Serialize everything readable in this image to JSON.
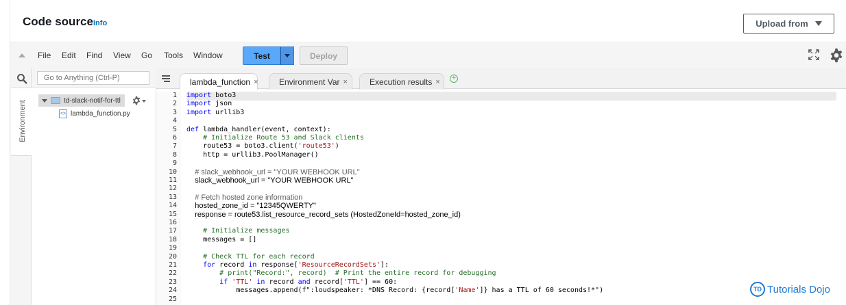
{
  "header": {
    "title": "Code source",
    "info": "Info",
    "upload": "Upload from"
  },
  "menu": {
    "items": [
      "File",
      "Edit",
      "Find",
      "View",
      "Go",
      "Tools",
      "Window"
    ],
    "test": "Test",
    "deploy": "Deploy"
  },
  "sidebar": {
    "search_placeholder": "Go to Anything (Ctrl-P)",
    "environment_tab": "Environment",
    "folder": "td-slack-notif-for-ttl",
    "file": "lambda_function.py"
  },
  "tabs": [
    {
      "label": "lambda_function",
      "close": "×"
    },
    {
      "label": "Environment Var",
      "close": "×"
    },
    {
      "label": "Execution results",
      "close": "×"
    }
  ],
  "add_tab": "+",
  "code_lines": [
    "import boto3",
    "import json",
    "import urllib3",
    "",
    "def lambda_handler(event, context):",
    "    # Initialize Route 53 and Slack clients",
    "    route53 = boto3.client('route53')",
    "    http = urllib3.PoolManager()",
    "",
    "    # slack_webhook_url = \"YOUR WEBHOOK URL\"",
    "    slack_webhook_url = \"YOUR WEBHOOK URL\"",
    "",
    "    # Fetch hosted zone information",
    "    hosted_zone_id = \"12345QWERTY\"",
    "    response = route53.list_resource_record_sets (HostedZoneId=hosted_zone_id)",
    "",
    "    # Initialize messages",
    "    messages = []",
    "",
    "    # Check TTL for each record",
    "    for record in response['ResourceRecordSets']:",
    "        # print(\"Record:\", record)  # Print the entire record for debugging",
    "        if 'TTL' in record and record['TTL'] == 60:",
    "            messages.append(f\":loudspeaker: *DNS Record: {record['Name']} has a TTL of 60 seconds!*\")",
    ""
  ],
  "line_numbers": [
    "1",
    "2",
    "3",
    "4",
    "5",
    "6",
    "7",
    "8",
    "9",
    "10",
    "11",
    "12",
    "13",
    "14",
    "15",
    "16",
    "17",
    "18",
    "19",
    "20",
    "21",
    "22",
    "23",
    "24",
    "25"
  ],
  "watermark": {
    "badge": "TD",
    "text": "Tutorials Dojo"
  },
  "colors": {
    "keyword": "#0000ff",
    "comment": "#236e25",
    "string": "#a31515",
    "test_button": "#59a8f9",
    "info_link": "#0073bb"
  }
}
